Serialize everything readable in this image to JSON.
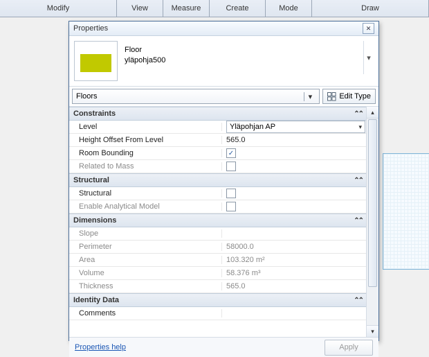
{
  "ribbon": {
    "modify": "Modify",
    "view": "View",
    "measure": "Measure",
    "create": "Create",
    "mode": "Mode",
    "draw": "Draw"
  },
  "panel": {
    "title": "Properties",
    "category": "Floor",
    "typeName": "yläpohja500",
    "filter": "Floors",
    "editType": "Edit Type",
    "help": "Properties help",
    "apply": "Apply"
  },
  "groups": {
    "constraints": "Constraints",
    "structural": "Structural",
    "dimensions": "Dimensions",
    "identity": "Identity Data"
  },
  "params": {
    "level": {
      "label": "Level",
      "value": "Yläpohjan AP"
    },
    "offset": {
      "label": "Height Offset From Level",
      "value": "565.0"
    },
    "roomBounding": {
      "label": "Room Bounding"
    },
    "relatedMass": {
      "label": "Related to Mass"
    },
    "structural": {
      "label": "Structural"
    },
    "analytical": {
      "label": "Enable Analytical Model"
    },
    "slope": {
      "label": "Slope",
      "value": ""
    },
    "perimeter": {
      "label": "Perimeter",
      "value": "58000.0"
    },
    "area": {
      "label": "Area",
      "value": "103.320 m²"
    },
    "volume": {
      "label": "Volume",
      "value": "58.376 m³"
    },
    "thickness": {
      "label": "Thickness",
      "value": "565.0"
    },
    "comments": {
      "label": "Comments",
      "value": ""
    }
  }
}
